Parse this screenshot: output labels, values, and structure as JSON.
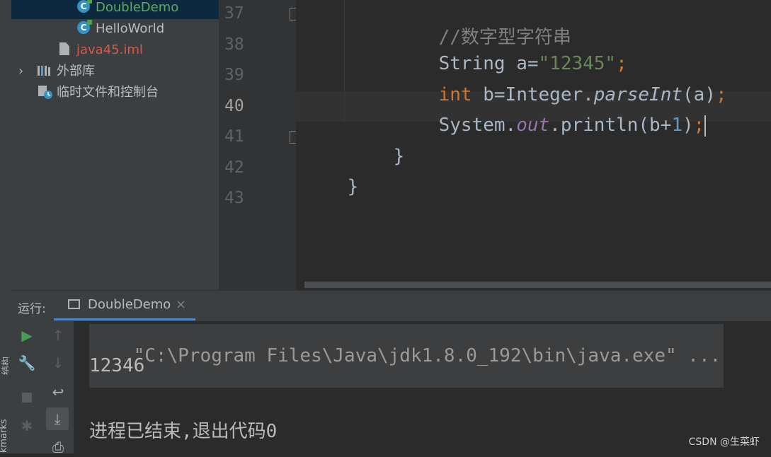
{
  "project_tree": {
    "items": [
      {
        "label": "DoubleDemo",
        "icon": "java-class-icon"
      },
      {
        "label": "HelloWorld",
        "icon": "java-class-icon"
      },
      {
        "label": "java45.iml",
        "icon": "iml-file-icon"
      },
      {
        "label": "外部库",
        "icon": "library-icon"
      },
      {
        "label": "临时文件和控制台",
        "icon": "scratch-console-icon"
      }
    ]
  },
  "editor": {
    "line_numbers": [
      "37",
      "38",
      "39",
      "40",
      "41",
      "42",
      "43"
    ],
    "lines": {
      "l37_comment": "//数字型字符串",
      "l38_type": "String",
      "l38_var": " a=",
      "l38_str": "\"12345\"",
      "l38_semi": ";",
      "l39_kw": "int",
      "l39_rest1": " b=Integer.",
      "l39_method": "parseInt",
      "l39_rest2": "(a)",
      "l39_semi": ";",
      "l40_rest1": "System.",
      "l40_field": "out",
      "l40_rest2": ".println(b+",
      "l40_num": "1",
      "l40_rest3": ")",
      "l40_semi": ";",
      "l41": "}",
      "l42": "}"
    }
  },
  "run_panel": {
    "label": "运行:",
    "tab_label": "DoubleDemo",
    "close_glyph": "×",
    "console": {
      "command": "\"C:\\Program Files\\Java\\jdk1.8.0_192\\bin\\java.exe\" ...",
      "output": "12346",
      "exit_message": "进程已结束,退出代码0"
    }
  },
  "side_strip": {
    "structure_label": "结构",
    "bookmarks_label": "Bookmarks"
  },
  "watermark": "CSDN @生菜虾",
  "colors": {
    "keyword": "#cc7832",
    "string": "#6a8759",
    "number": "#6897bb",
    "comment": "#808080",
    "method_italic": "#a9b7c6",
    "field": "#9876aa",
    "selection_bg": "#0d293e",
    "run_green": "#499c54"
  }
}
